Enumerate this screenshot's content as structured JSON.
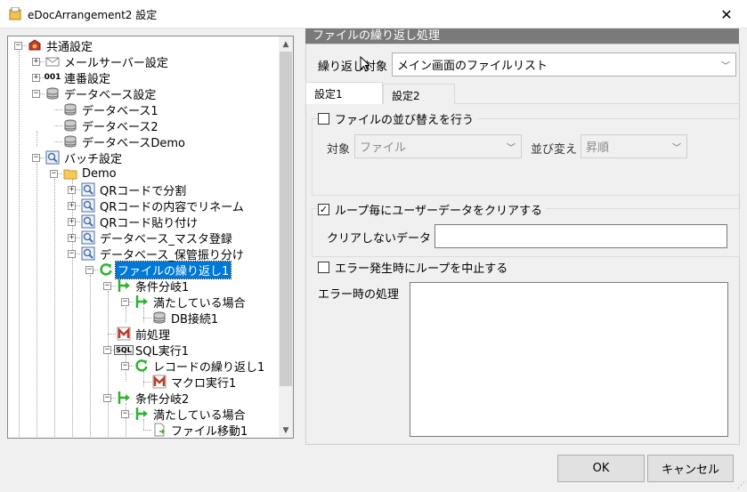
{
  "window": {
    "title": "eDocArrangement2 設定",
    "close_glyph": "✕"
  },
  "tree": {
    "nodes": [
      {
        "label": "共通設定",
        "icon": "gear-box-icon"
      },
      {
        "label": "メールサーバー設定",
        "icon": "mail-icon"
      },
      {
        "label": "連番設定",
        "icon": "sequence-001-icon",
        "icon_text": "001"
      },
      {
        "label": "データベース設定",
        "icon": "database-icon"
      },
      {
        "label": "データベース1",
        "icon": "database-icon"
      },
      {
        "label": "データベース2",
        "icon": "database-icon"
      },
      {
        "label": "データベースDemo",
        "icon": "database-icon"
      },
      {
        "label": "バッチ設定",
        "icon": "batch-icon"
      },
      {
        "label": "Demo",
        "icon": "folder-icon"
      },
      {
        "label": "QRコードで分割",
        "icon": "batch-icon"
      },
      {
        "label": "QRコードの内容でリネーム",
        "icon": "batch-icon"
      },
      {
        "label": "QRコード貼り付け",
        "icon": "batch-icon"
      },
      {
        "label": "データベース_マスタ登録",
        "icon": "batch-icon"
      },
      {
        "label": "データベース_保管振り分け",
        "icon": "batch-icon"
      },
      {
        "label": "ファイルの繰り返し1",
        "icon": "loop-icon",
        "selected": true
      },
      {
        "label": "条件分岐1",
        "icon": "branch-icon"
      },
      {
        "label": "満たしている場合",
        "icon": "branch-icon"
      },
      {
        "label": "DB接続1",
        "icon": "database-icon"
      },
      {
        "label": "前処理",
        "icon": "macro-icon"
      },
      {
        "label": "SQL実行1",
        "icon": "sql-icon",
        "icon_text": "SQL"
      },
      {
        "label": "レコードの繰り返し1",
        "icon": "loop-icon"
      },
      {
        "label": "マクロ実行1",
        "icon": "macro-icon"
      },
      {
        "label": "条件分岐2",
        "icon": "branch-icon"
      },
      {
        "label": "満たしている場合",
        "icon": "branch-icon"
      },
      {
        "label": "ファイル移動1",
        "icon": "file-move-icon"
      }
    ]
  },
  "panel": {
    "header": "ファイルの繰り返し処理",
    "repeat_target_label": "繰り返し対象",
    "repeat_target_value": "メイン画面のファイルリスト",
    "tabs": [
      {
        "label": "設定1"
      },
      {
        "label": "設定2"
      }
    ],
    "sort": {
      "checkbox_label": "ファイルの並び替えを行う",
      "target_label": "対象",
      "target_value": "ファイル",
      "order_label": "並び変え",
      "order_value": "昇順"
    },
    "clear": {
      "checkbox_label": "ループ毎にユーザーデータをクリアする",
      "checked_glyph": "✓",
      "keep_label": "クリアしないデータ"
    },
    "error": {
      "checkbox_label": "エラー発生時にループを中止する",
      "action_label": "エラー時の処理"
    }
  },
  "buttons": {
    "ok": "OK",
    "cancel": "キャンセル"
  },
  "colors": {
    "selection": "#0078d7",
    "header": "#7a7a7a",
    "branch_green": "#2db52d"
  }
}
